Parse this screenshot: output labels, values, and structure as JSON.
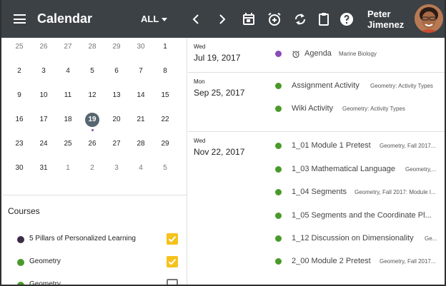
{
  "header": {
    "title": "Calendar",
    "filter_label": "ALL",
    "user_first": "Peter",
    "user_last": "Jimenez",
    "background": "#3c4145"
  },
  "mini_calendar": {
    "weeks": [
      [
        "25",
        "26",
        "27",
        "28",
        "29",
        "30",
        "1"
      ],
      [
        "2",
        "3",
        "4",
        "5",
        "6",
        "7",
        "8"
      ],
      [
        "9",
        "10",
        "11",
        "12",
        "13",
        "14",
        "15"
      ],
      [
        "16",
        "17",
        "18",
        "19",
        "20",
        "21",
        "22"
      ],
      [
        "23",
        "24",
        "25",
        "26",
        "27",
        "28",
        "29"
      ],
      [
        "30",
        "31",
        "1",
        "2",
        "3",
        "4",
        "5"
      ]
    ],
    "selected_day": "19",
    "today_color": "#576670"
  },
  "courses": {
    "title": "Courses",
    "items": [
      {
        "name": "5 Pillars of Personalized Learning",
        "color": "#3d2b47",
        "checked": true
      },
      {
        "name": "Geometry",
        "color": "#4a9a2a",
        "checked": true
      },
      {
        "name": "Geometry",
        "color": "#4a9a2a",
        "checked": false
      }
    ]
  },
  "agenda": [
    {
      "dow": "Wed",
      "date": "Jul 19, 2017",
      "events": [
        {
          "title": "Agenda",
          "sub": "Marine Biology",
          "color": "#8a4bb5",
          "alarm": true
        }
      ]
    },
    {
      "dow": "Mon",
      "date": "Sep 25, 2017",
      "events": [
        {
          "title": "Assignment Activity",
          "sub": "Geometry: Activity Types",
          "color": "#4a9a2a"
        },
        {
          "title": "Wiki Activity",
          "sub": "Geometry: Activity Types",
          "color": "#4a9a2a"
        }
      ]
    },
    {
      "dow": "Wed",
      "date": "Nov 22, 2017",
      "events": [
        {
          "title": "1_01 Module 1 Pretest",
          "sub": "Geometry, Fall 2017...",
          "color": "#4a9a2a"
        },
        {
          "title": "1_03 Mathematical Language",
          "sub": "Geometry,...",
          "color": "#4a9a2a"
        },
        {
          "title": "1_04 Segments",
          "sub": "Geometry, Fall 2017: Module I...",
          "color": "#4a9a2a"
        },
        {
          "title": "1_05 Segments and the Coordinate Pl...",
          "sub": "",
          "color": "#4a9a2a"
        },
        {
          "title": "1_12 Discussion on Dimensionality",
          "sub": "Ge...",
          "color": "#4a9a2a"
        },
        {
          "title": "2_00 Module 2 Pretest",
          "sub": "Geometry, Fall 2017...",
          "color": "#4a9a2a"
        }
      ]
    }
  ],
  "icons": {
    "menu": "menu-icon",
    "prev": "chevron-left-icon",
    "next": "chevron-right-icon",
    "today": "calendar-icon",
    "alarm_add": "alarm-add-icon",
    "sync": "sync-icon",
    "clipboard": "clipboard-icon",
    "help": "help-icon"
  }
}
